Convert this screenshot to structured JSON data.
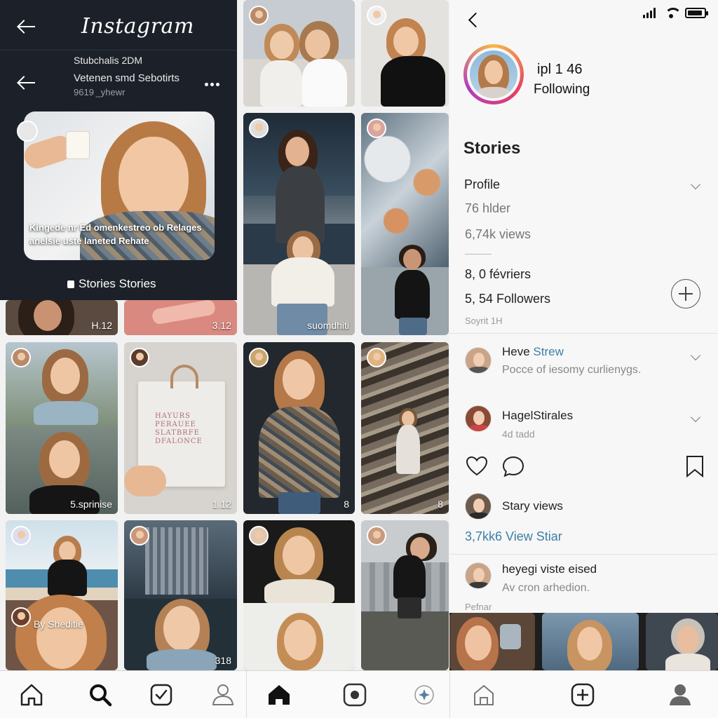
{
  "app": {
    "logo_text": "Instagram"
  },
  "left_panel": {
    "line1": "Stubchalis 2DM",
    "line2": "Vetenen smd Sebotirts",
    "line3": "9619 _yhewr",
    "story_overlay_text": "Kingede nr Ed omenkestreo ob Relages anelsie uste laneted Rehate",
    "stories_label": "Stories Stories"
  },
  "grid_captions": {
    "c_r2_1": "H.12",
    "c_r2_2": "3.12",
    "c_r2_3": "suomdhiti",
    "c_r3_1": "5.sprinise",
    "c_r3_2": "1.12",
    "c_r3_3": "8",
    "c_r3_4": "8",
    "c_r4_1": "By Sheditie",
    "c_r4_2": "318",
    "bag_text": "HAYURS PERAUEE SLATBRFE DFALONCE"
  },
  "right_panel": {
    "stat_line1": "ipl 1 46",
    "stat_line2": "Following",
    "stories_heading": "Stories",
    "profile_label": "Profile",
    "holder_count": "76 hlder",
    "views_count": "6,74k views",
    "reviews": "8, 0 févriers",
    "followers": "5, 54 Followers",
    "sorit": "Soyrit 1H",
    "item1_title": "Heve",
    "item1_title_accent": "Strew",
    "item1_sub": "Pocce of iesomy curlienygs.",
    "item2_title": "HagelStirales",
    "item2_sub": "4d tadd",
    "story_views_label": "Stary views",
    "view_star": "3,7kk6 View Stiar",
    "accent_color": "#3d7fa6",
    "item3_title": "heyegi viste eised",
    "item3_sub": "Av cron arhedion.",
    "footer_label": "Pefnar"
  },
  "icons": {
    "heart": "heart-icon",
    "comment": "comment-icon",
    "bookmark": "bookmark-icon",
    "nav": [
      "home-icon",
      "search-icon",
      "activity-icon",
      "profile-icon",
      "home-filled-icon",
      "reels-icon",
      "explore-icon",
      "shop-icon",
      "add-icon",
      "account-icon"
    ]
  }
}
